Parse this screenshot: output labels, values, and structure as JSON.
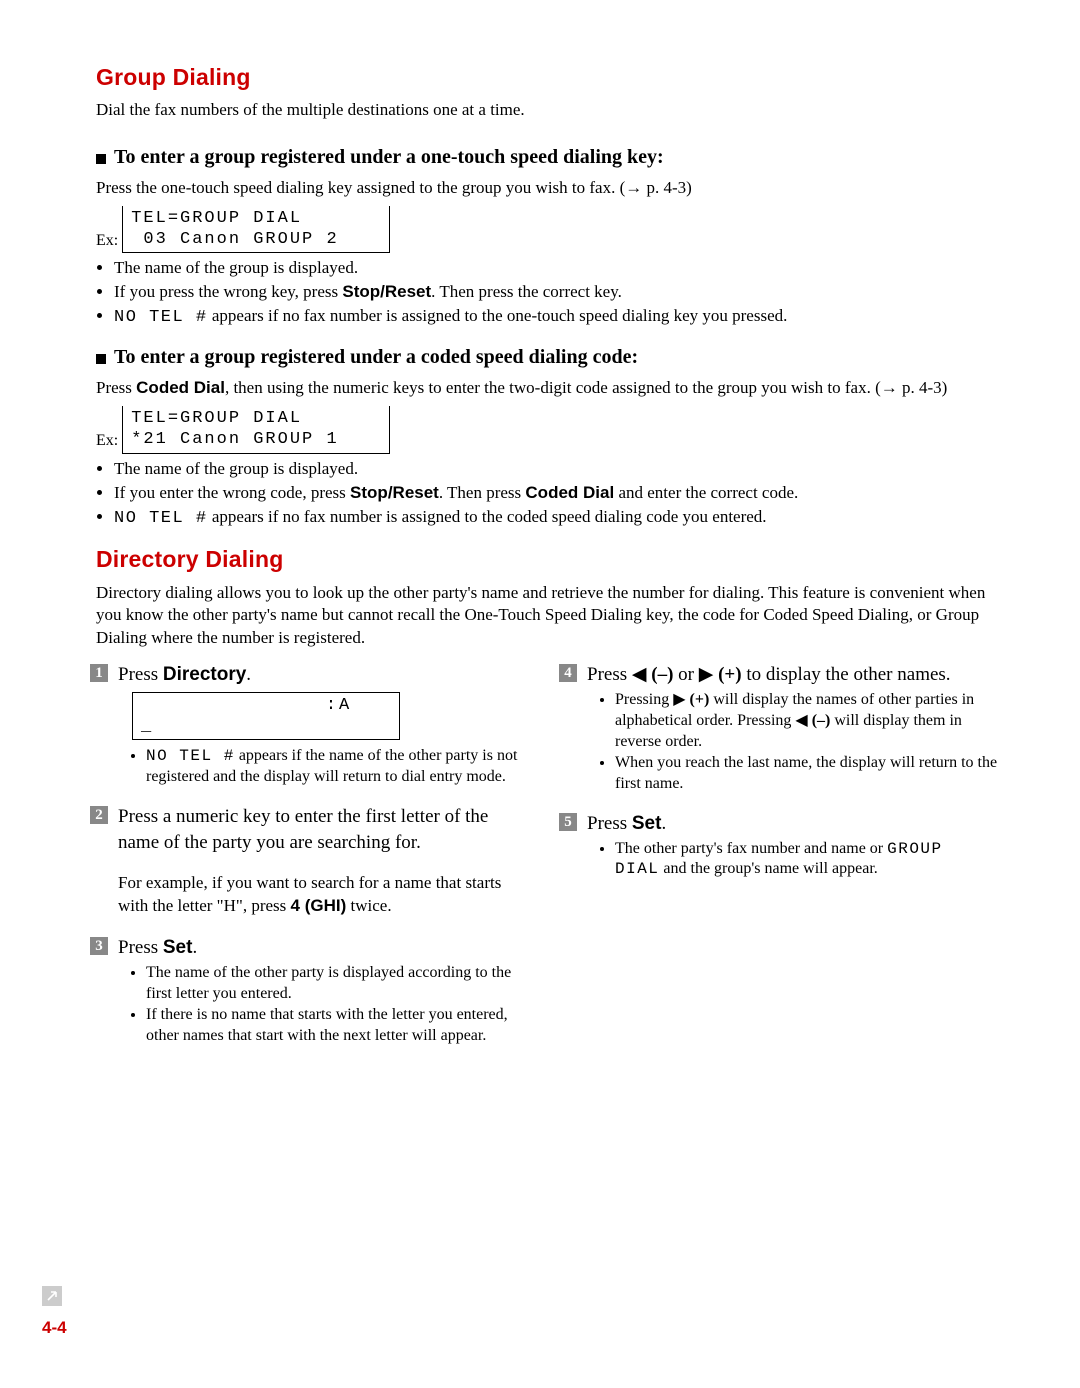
{
  "h1_group": "Group Dialing",
  "intro_group": "Dial the fax numbers of the multiple destinations one at a time.",
  "h2_onetouch": "To enter a group registered under a one-touch speed dialing key:",
  "onetouch_press_1": "Press the one-touch speed dialing key assigned to the group you wish to fax. (",
  "arrow": "→",
  "onetouch_press_pageref": " p. 4-3)",
  "ex_label": "Ex:",
  "lcd_onetouch_line1": "TEL=GROUP DIAL",
  "lcd_onetouch_line2": " 03 Canon GROUP 2",
  "onetouch_b1": "The name of the group is displayed.",
  "onetouch_b2_a": "If you press the wrong key, press ",
  "stop_reset": "Stop/Reset",
  "onetouch_b2_b": ". Then press the correct key.",
  "no_tel": "NO TEL #",
  "onetouch_b3": " appears if no fax number is assigned to the one-touch speed dialing key you pressed.",
  "h2_coded": "To enter a group registered under a coded speed dialing code:",
  "coded_press_a": "Press ",
  "coded_dial": "Coded Dial",
  "coded_press_b": ", then using the numeric keys to enter the two-digit code assigned to the group you wish to fax. (",
  "lcd_coded_line1": "TEL=GROUP DIAL",
  "lcd_coded_line2": "*21 Canon GROUP 1",
  "coded_b1": "The name of the group is displayed.",
  "coded_b2_a": "If you enter the wrong code, press ",
  "coded_b2_b": ". Then press ",
  "coded_b2_c": " and enter the correct code.",
  "coded_b3": " appears if no fax number is assigned to the coded speed dialing code you entered.",
  "h1_dir": "Directory Dialing",
  "dir_intro": "Directory dialing allows you to look up the other party's name and retrieve the number for dialing. This feature is convenient when you know the other party's name but cannot recall the One-Touch Speed Dialing key, the code for Coded Speed Dialing, or Group Dialing where the number is registered.",
  "steps": {
    "s1": {
      "num": "1",
      "head_a": "Press ",
      "head_b": "Directory",
      "head_c": ".",
      "lcd": "              :A\n_",
      "b1_a": " appears if the name of the other party is not registered and the display will return to dial entry mode."
    },
    "s2": {
      "num": "2",
      "head": "Press a numeric key to enter the first letter of the name of the party you are searching for.",
      "body_a": "For example, if you want to search for a name that starts with the letter \"H\", press ",
      "body_b": "4 (GHI)",
      "body_c": " twice."
    },
    "s3": {
      "num": "3",
      "head_a": "Press ",
      "head_b": "Set",
      "head_c": ".",
      "b1": "The name of the other party is displayed according to the first letter you entered.",
      "b2": "If there is no name that starts with the letter you entered, other names that start with the next letter will appear."
    },
    "s4": {
      "num": "4",
      "head_a": "Press ",
      "left_tri": "◀",
      "minus": " (–)",
      "or": " or ",
      "right_tri": "▶",
      "plus": " (+)",
      "head_b": " to display the other names.",
      "b1_a": "Pressing ",
      "b1_b": " will display the names of other parties in alphabetical order. Pressing ",
      "b1_c": " will display them in reverse order.",
      "b2": "When you reach the last name, the display will return to the first name."
    },
    "s5": {
      "num": "5",
      "head_a": "Press ",
      "head_b": "Set",
      "head_c": ".",
      "b1_a": "The other party's fax number and name or ",
      "group_dial_mono": "GROUP DIAL",
      "b1_b": " and the group's name will appear."
    }
  },
  "page_num": "4-4"
}
